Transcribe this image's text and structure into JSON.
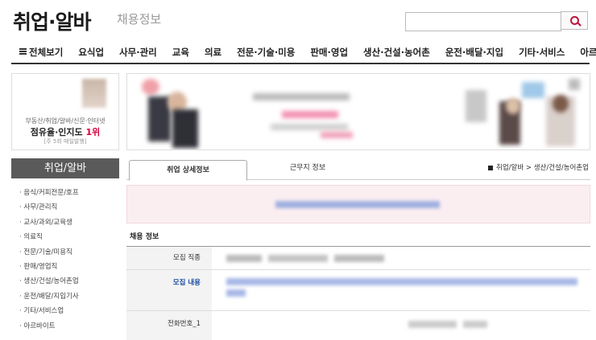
{
  "header": {
    "logo": "취업·알바",
    "subtitle": "채용정보",
    "search": {
      "value": ""
    }
  },
  "nav": {
    "items": [
      "전체보기",
      "요식업",
      "사무·관리",
      "교육",
      "의료",
      "전문·기술·미용",
      "판매·영업",
      "생산·건설·농어촌",
      "운전·배달·지입",
      "기타·서비스",
      "아르바이트"
    ]
  },
  "left_ad": {
    "line1": "부동산/취업/알바/신문·인터넷",
    "line2_pre": "점유율·인지도 ",
    "line2_em": "1위",
    "line3": "[주 5회 매일발행]"
  },
  "category": {
    "title": "취업/알바",
    "items": [
      "· 음식/커피전문/호프",
      "· 사무/관리직",
      "· 교사/과외/교육생",
      "· 의료직",
      "· 전문/기술/미용직",
      "· 판매/영업직",
      "· 생산/건설/농어촌업",
      "· 운전/배달/지입기사",
      "· 기타/서비스업",
      "· 아르바이트"
    ]
  },
  "tabs": {
    "active": "취업 상세정보",
    "second": "근무지 정보"
  },
  "breadcrumb": {
    "home": "취업/알바",
    "sep": " > ",
    "current": "생산/건설/농어촌업"
  },
  "section_title": "채용 정보",
  "fields": {
    "row1": "모집 직종",
    "row2": "모집 내용",
    "row3": "전화번호_1"
  },
  "colors": {
    "accent": "#c0143c",
    "link": "#1a4ba0",
    "nav_border": "#333333"
  },
  "icons": {
    "search": "magnifier-icon",
    "menu": "hamburger-icon"
  }
}
